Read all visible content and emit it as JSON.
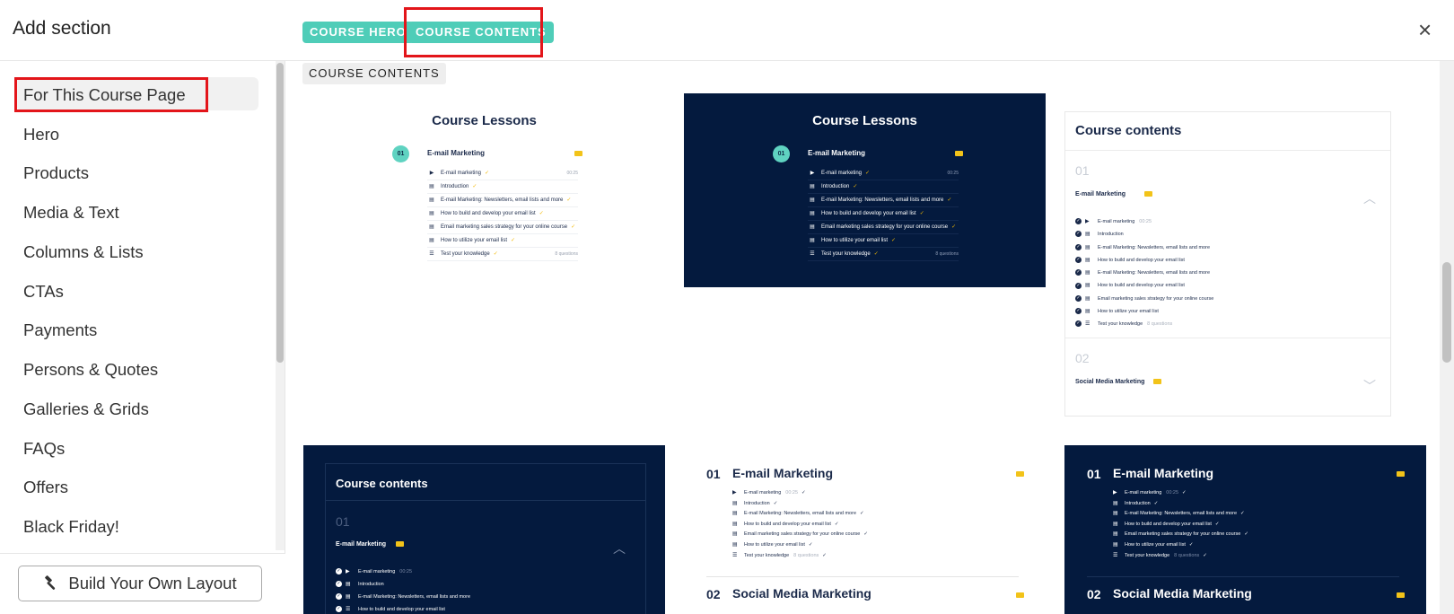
{
  "header": {
    "title": "Add section",
    "tabs": [
      "COURSE HERO",
      "COURSE CONTENTS"
    ],
    "close_icon": "×"
  },
  "sidebar": {
    "selected": "For This Course Page",
    "items": [
      "For This Course Page",
      "Hero",
      "Products",
      "Media & Text",
      "Columns & Lists",
      "CTAs",
      "Payments",
      "Persons & Quotes",
      "Galleries & Grids",
      "FAQs",
      "Offers",
      "Black Friday!"
    ],
    "build_button": "Build Your Own Layout",
    "build_icon": "hammer-icon"
  },
  "main": {
    "section_label": "COURSE CONTENTS",
    "card1": {
      "title": "Course Lessons",
      "badge": "01",
      "module": "E-mail Marketing",
      "lessons": [
        {
          "icon": "play-icon",
          "text": "E-mail marketing",
          "right": "00:25"
        },
        {
          "icon": "book-icon",
          "text": "Introduction",
          "right": ""
        },
        {
          "icon": "book-icon",
          "text": "E-mail Marketing: Newsletters, email lists and more",
          "right": ""
        },
        {
          "icon": "book-icon",
          "text": "How to build and develop your email list",
          "right": ""
        },
        {
          "icon": "book-icon",
          "text": "Email marketing sales strategy for your online course",
          "right": ""
        },
        {
          "icon": "book-icon",
          "text": "How to utilize your email list",
          "right": ""
        },
        {
          "icon": "list-icon",
          "text": "Test your knowledge",
          "right": "8 questions"
        }
      ]
    },
    "card3": {
      "title": "Course contents",
      "module1_num": "01",
      "module1": "E-mail Marketing",
      "items": [
        {
          "text": "E-mail marketing",
          "extra": "00:25"
        },
        {
          "text": "Introduction",
          "extra": ""
        },
        {
          "text": "E-mail Marketing: Newsletters, email lists and more",
          "extra": ""
        },
        {
          "text": "How to build and develop your email list",
          "extra": ""
        },
        {
          "text": "E-mail Marketing: Newsletters, email lists and more",
          "extra": ""
        },
        {
          "text": "How to build and develop your email list",
          "extra": ""
        },
        {
          "text": "Email marketing sales strategy for your online course",
          "extra": ""
        },
        {
          "text": "How to utilize your email list",
          "extra": ""
        },
        {
          "text": "Test your knowledge",
          "extra": "8 questions"
        }
      ],
      "module2_num": "02",
      "module2": "Social Media Marketing"
    },
    "card4": {
      "title": "Course contents",
      "module_num": "01",
      "module": "E-mail Marketing",
      "items": [
        {
          "text": "E-mail marketing",
          "extra": "00:25"
        },
        {
          "text": "Introduction",
          "extra": ""
        },
        {
          "text": "E-mail Marketing: Newsletters, email lists and more",
          "extra": ""
        },
        {
          "text": "How to build and develop your email list",
          "extra": ""
        }
      ]
    },
    "card5": {
      "num1": "01",
      "heading1": "E-mail Marketing",
      "items": [
        {
          "icon": "play-icon",
          "text": "E-mail marketing",
          "extra": "00:25"
        },
        {
          "icon": "book-icon",
          "text": "Introduction",
          "extra": ""
        },
        {
          "icon": "book-icon",
          "text": "E-mail Marketing: Newsletters, email lists and more",
          "extra": ""
        },
        {
          "icon": "book-icon",
          "text": "How to build and develop your email list",
          "extra": ""
        },
        {
          "icon": "book-icon",
          "text": "Email marketing sales strategy for your online course",
          "extra": ""
        },
        {
          "icon": "book-icon",
          "text": "How to utilize your email list",
          "extra": ""
        },
        {
          "icon": "list-icon",
          "text": "Test your knowledge",
          "extra": "8 questions"
        }
      ],
      "num2": "02",
      "heading2": "Social Media Marketing"
    },
    "colors": {
      "accent": "#4fcdb8",
      "navy": "#041a3e",
      "highlight": "#e3151a",
      "check": "#f2b800"
    }
  }
}
